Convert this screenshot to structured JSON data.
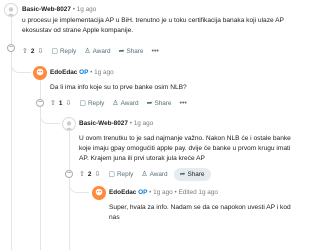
{
  "comments": [
    {
      "author": "Basic-Web-8027",
      "time": "1g ago",
      "text": "u procesu je implementacija AP u BiH. trenutno je u toku certifikacija banaka koji ulaze AP ekosustav od strane Apple kompanije.",
      "votes": "2",
      "reply_label": "Reply",
      "award_label": "Award",
      "share_label": "Share"
    },
    {
      "author": "EdoEdac",
      "op_label": "OP",
      "time": "1g ago",
      "text": "Da li ima info koje su to prve banke osim NLB?",
      "votes": "1",
      "reply_label": "Reply",
      "award_label": "Award",
      "share_label": "Share"
    },
    {
      "author": "Basic-Web-8027",
      "time": "1g ago",
      "text": "U ovom trenutku to je sad najmanje važno. Nakon NLB će i ostale banke koje imaju gpay omogućiti apple pay. dvije će banke u prvom krugu imati AP. Krajem juna ili prvi utorak jula kreće AP",
      "votes": "2",
      "reply_label": "Reply",
      "award_label": "Award",
      "share_label": "Share"
    },
    {
      "author": "EdoEdac",
      "op_label": "OP",
      "time": "1g ago",
      "edited": "Edited 1g ago",
      "text": "Super, hvala za info. Nadam se da ce napokon uvesti AP i kod nas",
      "votes": "",
      "reply_label": "",
      "award_label": "",
      "share_label": ""
    }
  ]
}
